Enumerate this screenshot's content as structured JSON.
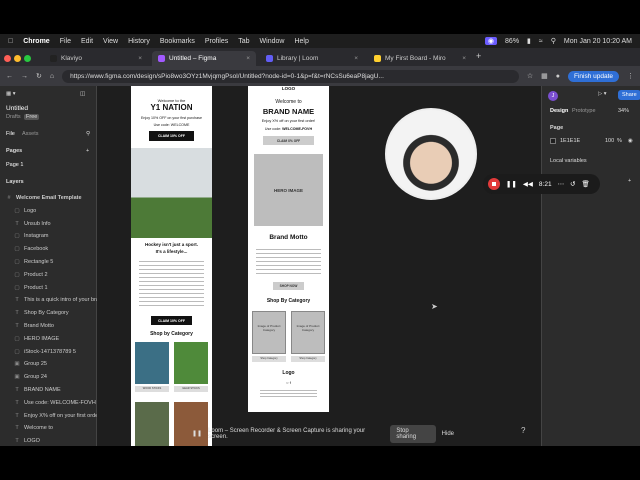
{
  "menubar": {
    "app": "Chrome",
    "items": [
      "File",
      "Edit",
      "View",
      "History",
      "Bookmarks",
      "Profiles",
      "Tab",
      "Window",
      "Help"
    ],
    "battery": "86%",
    "datetime": "Mon Jan 20  10:20 AM"
  },
  "tabs": [
    {
      "label": "Klaviyo",
      "color": "#222222"
    },
    {
      "label": "Untitled – Figma",
      "color": "#a259ff"
    },
    {
      "label": "Library | Loom",
      "color": "#625df5"
    },
    {
      "label": "My First Board - Miro",
      "color": "#ffd02f"
    }
  ],
  "address": {
    "url": "https://www.figma.com/design/sPio8wo3OYz1MvjqmgPsol/Untitled?node-id=0-1&p=f&t=rNCsSu6eaP8jagU...",
    "finish_label": "Finish update"
  },
  "left_panel": {
    "file_name": "Untitled",
    "drafts_label": "Drafts",
    "free_badge": "Free",
    "tab_file": "File",
    "tab_assets": "Assets",
    "pages_label": "Pages",
    "page1": "Page 1",
    "layers_label": "Layers",
    "layers": [
      "Welcome Email Template",
      "Logo",
      "Unsub Info",
      "Instagram",
      "Facebook",
      "Rectangle 5",
      "Product 2",
      "Product 1",
      "This is a quick intro of your brand",
      "Shop By Category",
      "Brand Motto",
      "HERO IMAGE",
      "iStock-1471378789 5",
      "Group 25",
      "Group 24",
      "BRAND NAME",
      "Use code: WELCOME-FOVH",
      "Enjoy X% off on your first order!",
      "Welcome to",
      "LOGO"
    ]
  },
  "right_panel": {
    "tab_design": "Design",
    "tab_prototype": "Prototype",
    "zoom": "34%",
    "share": "Share",
    "avatar": "J",
    "page_label": "Page",
    "page_color_hex": "1E1E1E",
    "page_opacity": "100",
    "page_opacity_unit": "%",
    "local_variables": "Local variables"
  },
  "frame1": {
    "welcome": "Welcome to the",
    "brand": "Y1 NATION",
    "offer": "Enjoy 10% OFF on your first purchase",
    "code": "Use code: WELCOME",
    "claim": "CLAIM 10% OFF",
    "headline1": "Hockey isn't just a sport.",
    "headline2": "It's a lifestyle...",
    "claim2": "CLAIM 10% OFF",
    "shop": "Shop by Category",
    "cat1": "WOOD STICKS",
    "cat2": "GEAR STICKS"
  },
  "frame2": {
    "logo": "LOGO",
    "welcome": "Welcome to",
    "brand": "BRAND NAME",
    "offer": "Enjoy X% off on your first order!",
    "code_prefix": "Use code: ",
    "code": "WELCOME-FOVH",
    "claim": "CLAIM X% OFF",
    "hero": "HERO IMAGE",
    "motto": "Brand Motto",
    "shop_now": "SHOP NOW",
    "shop_category": "Shop By Category",
    "prod1": "Image of Product Category",
    "prod2": "Image of Product Category",
    "shop_btn1": "Shop Category",
    "shop_btn2": "Shop Category",
    "footer_logo": "Logo"
  },
  "recorder": {
    "time": "8:21"
  },
  "sharing": {
    "message": "Loom – Screen Recorder & Screen Capture is sharing your screen.",
    "stop": "Stop sharing",
    "hide": "Hide"
  }
}
